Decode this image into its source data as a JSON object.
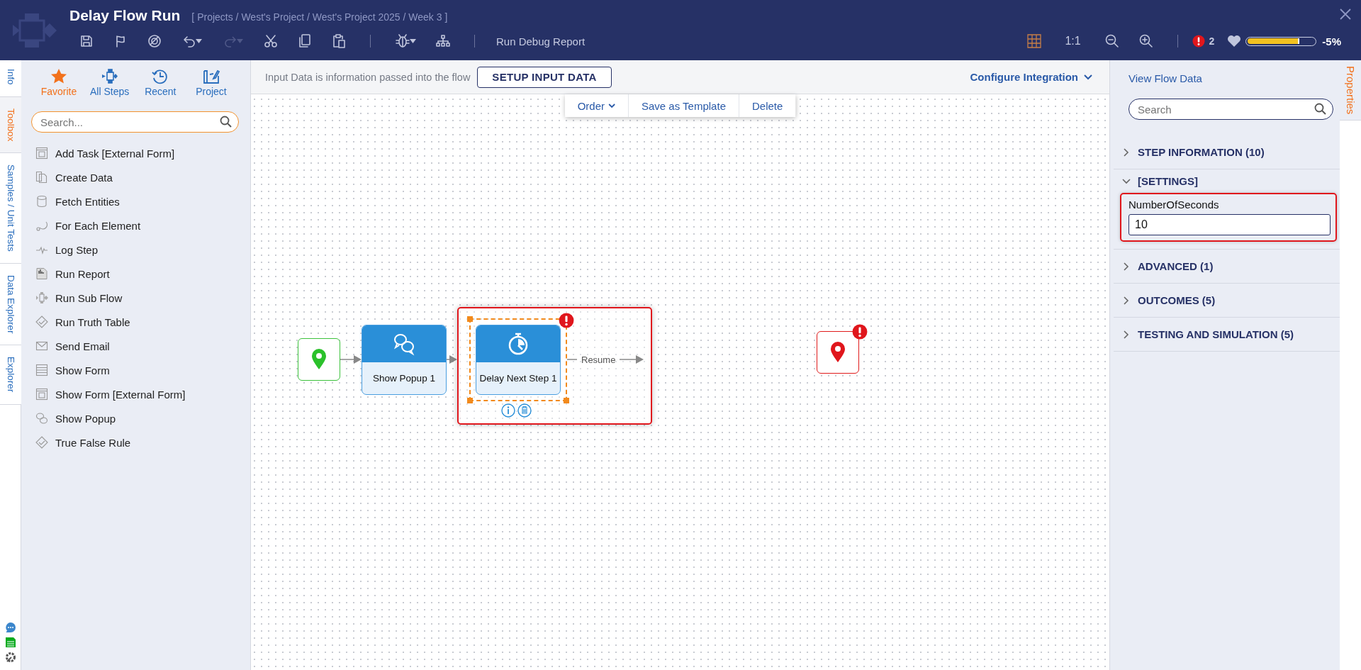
{
  "window": {
    "title": "Delay Flow Run",
    "breadcrumb": "[ Projects / West's Project / West's Project 2025 / Week 3 ]"
  },
  "toolbar": {
    "run_debug_report": "Run Debug Report",
    "zoom_ratio": "1:1",
    "error_count": "2",
    "health": {
      "level": 0.77,
      "reading": "-5%"
    }
  },
  "left_tabs": [
    {
      "label": "Info",
      "selected": false
    },
    {
      "label": "Toolbox",
      "selected": true
    },
    {
      "label": "Samples / Unit Tests",
      "selected": false
    },
    {
      "label": "Data Explorer",
      "selected": false
    },
    {
      "label": "Explorer",
      "selected": false
    }
  ],
  "toolbox": {
    "tabs": [
      {
        "label": "Favorite",
        "kind": "star",
        "selected": true
      },
      {
        "label": "All Steps",
        "kind": "steps",
        "selected": false
      },
      {
        "label": "Recent",
        "kind": "clock",
        "selected": false
      },
      {
        "label": "Project",
        "kind": "project",
        "selected": false
      }
    ],
    "search": {
      "placeholder": "Search..."
    },
    "items": [
      {
        "label": "Add Task [External Form]",
        "kind": "form"
      },
      {
        "label": "Create Data",
        "kind": "copy"
      },
      {
        "label": "Fetch Entities",
        "kind": "database"
      },
      {
        "label": "For Each Element",
        "kind": "loop"
      },
      {
        "label": "Log Step",
        "kind": "pulse"
      },
      {
        "label": "Run Report",
        "kind": "report"
      },
      {
        "label": "Run Sub Flow",
        "kind": "flow"
      },
      {
        "label": "Run Truth Table",
        "kind": "check"
      },
      {
        "label": "Send Email",
        "kind": "email"
      },
      {
        "label": "Show Form",
        "kind": "lines"
      },
      {
        "label": "Show Form [External Form]",
        "kind": "form"
      },
      {
        "label": "Show Popup",
        "kind": "chat"
      },
      {
        "label": "True False Rule",
        "kind": "check"
      }
    ]
  },
  "canvas": {
    "input_note": "Input Data is information passed into the flow",
    "setup_button": "SETUP INPUT DATA",
    "configure_integration": "Configure Integration",
    "context_menu": [
      {
        "label": "Order",
        "kind": "dropdown"
      },
      {
        "label": "Save as Template",
        "kind": "button"
      },
      {
        "label": "Delete",
        "kind": "button"
      }
    ],
    "nodes": [
      {
        "kind": "start",
        "error": false
      },
      {
        "kind": "popup",
        "label": "Show Popup 1",
        "selected": false,
        "error": false
      },
      {
        "kind": "delay",
        "label": "Delay Next Step 1",
        "selected": true,
        "error": true,
        "outcome": "Resume"
      },
      {
        "kind": "end",
        "error": true
      }
    ]
  },
  "properties": {
    "view_flow_data": "View Flow Data",
    "search": {
      "placeholder": "Search"
    },
    "sections": [
      {
        "title": "STEP INFORMATION (10)",
        "expanded": false
      },
      {
        "title": "[SETTINGS]",
        "expanded": true,
        "fields": [
          {
            "label": "NumberOfSeconds",
            "value": "10"
          }
        ]
      },
      {
        "title": "ADVANCED (1)",
        "expanded": false
      },
      {
        "title": "OUTCOMES (5)",
        "expanded": false
      },
      {
        "title": "TESTING AND SIMULATION (5)",
        "expanded": false
      }
    ]
  },
  "right_tabs": [
    {
      "label": "Properties",
      "selected": true
    }
  ]
}
